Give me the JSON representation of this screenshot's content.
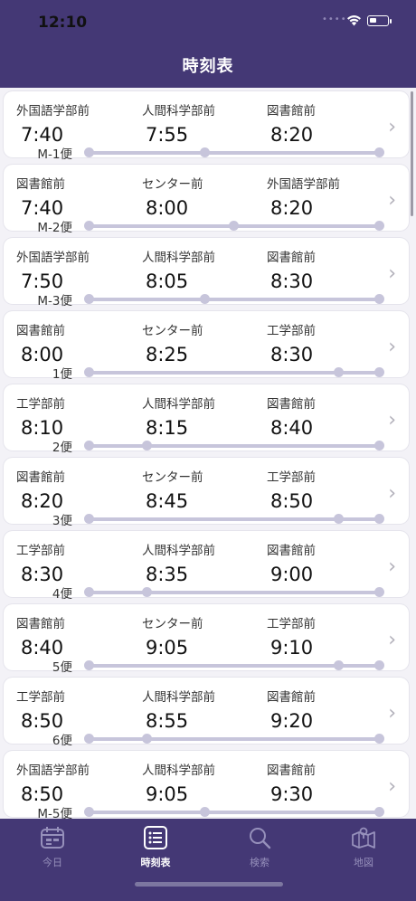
{
  "status_bar": {
    "time": "12:10"
  },
  "nav": {
    "title": "時刻表"
  },
  "trips": [
    {
      "label": "M-1便",
      "stops": [
        "外国語学部前",
        "人間科学部前",
        "図書館前"
      ],
      "times": [
        "7:40",
        "7:55",
        "8:20"
      ],
      "progress": 0.4
    },
    {
      "label": "M-2便",
      "stops": [
        "図書館前",
        "センター前",
        "外国語学部前"
      ],
      "times": [
        "7:40",
        "8:00",
        "8:20"
      ],
      "progress": 0.5
    },
    {
      "label": "M-3便",
      "stops": [
        "外国語学部前",
        "人間科学部前",
        "図書館前"
      ],
      "times": [
        "7:50",
        "8:05",
        "8:30"
      ],
      "progress": 0.4
    },
    {
      "label": "1便",
      "stops": [
        "図書館前",
        "センター前",
        "工学部前"
      ],
      "times": [
        "8:00",
        "8:25",
        "8:30"
      ],
      "progress": 0.86
    },
    {
      "label": "2便",
      "stops": [
        "工学部前",
        "人間科学部前",
        "図書館前"
      ],
      "times": [
        "8:10",
        "8:15",
        "8:40"
      ],
      "progress": 0.2
    },
    {
      "label": "3便",
      "stops": [
        "図書館前",
        "センター前",
        "工学部前"
      ],
      "times": [
        "8:20",
        "8:45",
        "8:50"
      ],
      "progress": 0.86
    },
    {
      "label": "4便",
      "stops": [
        "工学部前",
        "人間科学部前",
        "図書館前"
      ],
      "times": [
        "8:30",
        "8:35",
        "9:00"
      ],
      "progress": 0.2
    },
    {
      "label": "5便",
      "stops": [
        "図書館前",
        "センター前",
        "工学部前"
      ],
      "times": [
        "8:40",
        "9:05",
        "9:10"
      ],
      "progress": 0.86
    },
    {
      "label": "6便",
      "stops": [
        "工学部前",
        "人間科学部前",
        "図書館前"
      ],
      "times": [
        "8:50",
        "8:55",
        "9:20"
      ],
      "progress": 0.2
    },
    {
      "label": "M-5便",
      "stops": [
        "外国語学部前",
        "人間科学部前",
        "図書館前"
      ],
      "times": [
        "8:50",
        "9:05",
        "9:30"
      ],
      "progress": 0.4
    }
  ],
  "tabs": [
    {
      "label": "今日",
      "icon": "calendar-icon",
      "active": false
    },
    {
      "label": "時刻表",
      "icon": "timetable-list-icon",
      "active": true
    },
    {
      "label": "検索",
      "icon": "search-icon",
      "active": false
    },
    {
      "label": "地図",
      "icon": "map-icon",
      "active": false
    }
  ],
  "colors": {
    "header": "#443875",
    "tab_active": "#ffffff",
    "tab_inactive": "#9690bb",
    "track": "#c7c5db"
  }
}
